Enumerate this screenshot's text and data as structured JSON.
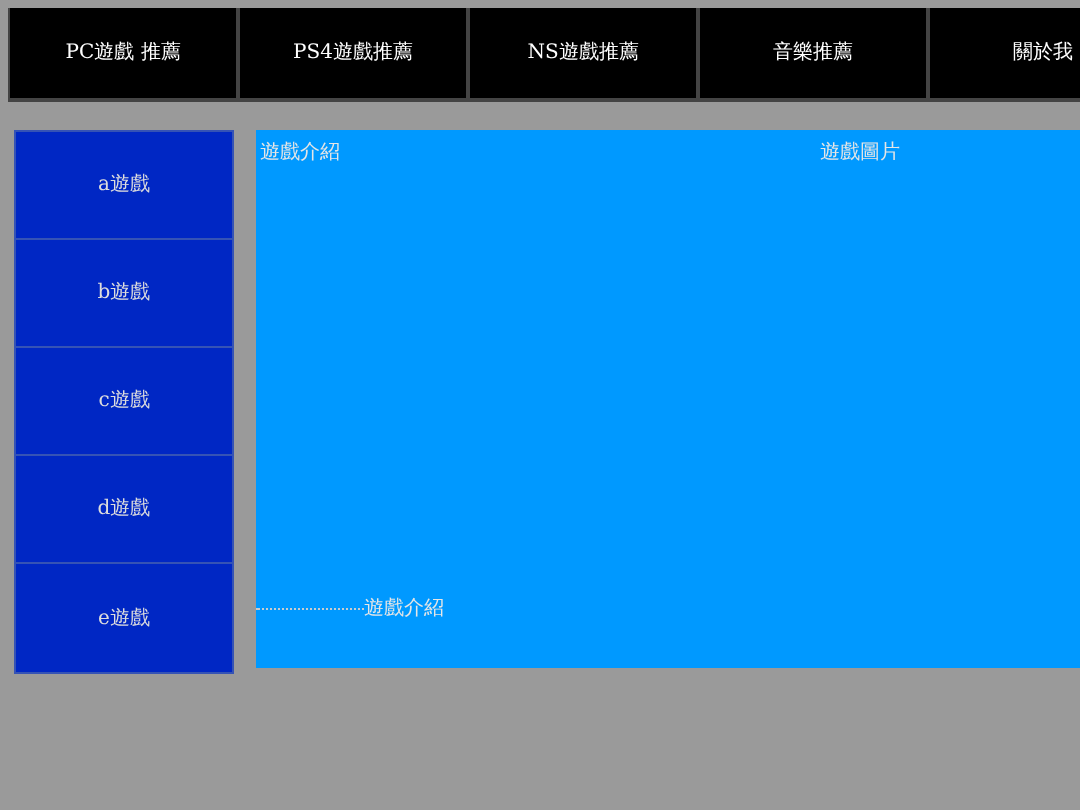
{
  "nav": [
    {
      "label": "PC遊戲 推薦"
    },
    {
      "label": "PS4遊戲推薦"
    },
    {
      "label": "NS遊戲推薦"
    },
    {
      "label": "音樂推薦"
    },
    {
      "label": "關於我"
    }
  ],
  "sidebar": {
    "items": [
      {
        "label": "a遊戲"
      },
      {
        "label": "b遊戲"
      },
      {
        "label": "c遊戲"
      },
      {
        "label": "d遊戲"
      },
      {
        "label": "e遊戲"
      }
    ]
  },
  "panel": {
    "intro_top": "遊戲介紹",
    "image_label": "遊戲圖片",
    "intro_bottom": "遊戲介紹"
  }
}
